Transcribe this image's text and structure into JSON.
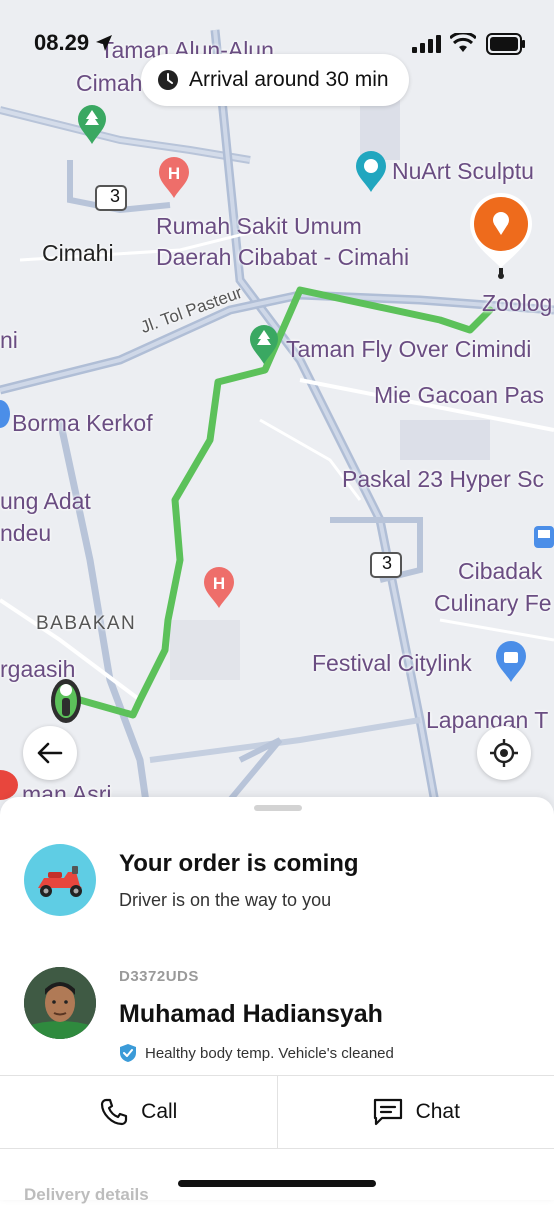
{
  "status_bar": {
    "time": "08.29"
  },
  "map": {
    "arrival_text": "Arrival around 30 min",
    "labels": {
      "taman_alun": "Taman Alun-Alun",
      "cimahi_top": "Cimahi",
      "nuart": "NuArt Sculptu",
      "road_3": "3",
      "rumah_sakit": "Rumah Sakit Umum\nDaerah Cibabat - Cimahi",
      "cimahi": "Cimahi",
      "zoolog": "Zoolog",
      "tol_pasteur": "Jl. Tol Pasteur",
      "ni": "ni",
      "taman_fly": "Taman Fly Over Cimindi",
      "mie_gacoan": "Mie Gacoan Pas",
      "borma": "Borma Kerkof",
      "paskal": "Paskal 23 Hyper Sc",
      "ung_adat": "ung Adat",
      "ndeu": "ndeu",
      "cibadak": "Cibadak",
      "culinary": "Culinary Fe",
      "babakan": "BABAKAN",
      "festival": "Festival Citylink",
      "rgaasih": "rgaasih",
      "lapangan": "Lapangan T",
      "man_asri": "man Asri"
    }
  },
  "order": {
    "title": "Your order is coming",
    "subtitle": "Driver is on the way to you"
  },
  "driver": {
    "plate": "D3372UDS",
    "name": "Muhamad Hadiansyah",
    "health_note": "Healthy body temp. Vehicle's cleaned"
  },
  "actions": {
    "call": "Call",
    "chat": "Chat"
  },
  "delivery_details": "Delivery details",
  "colors": {
    "route": "#5cc15a",
    "destination_pin": "#ee6b1c",
    "order_icon_bg": "#5fcde4"
  }
}
